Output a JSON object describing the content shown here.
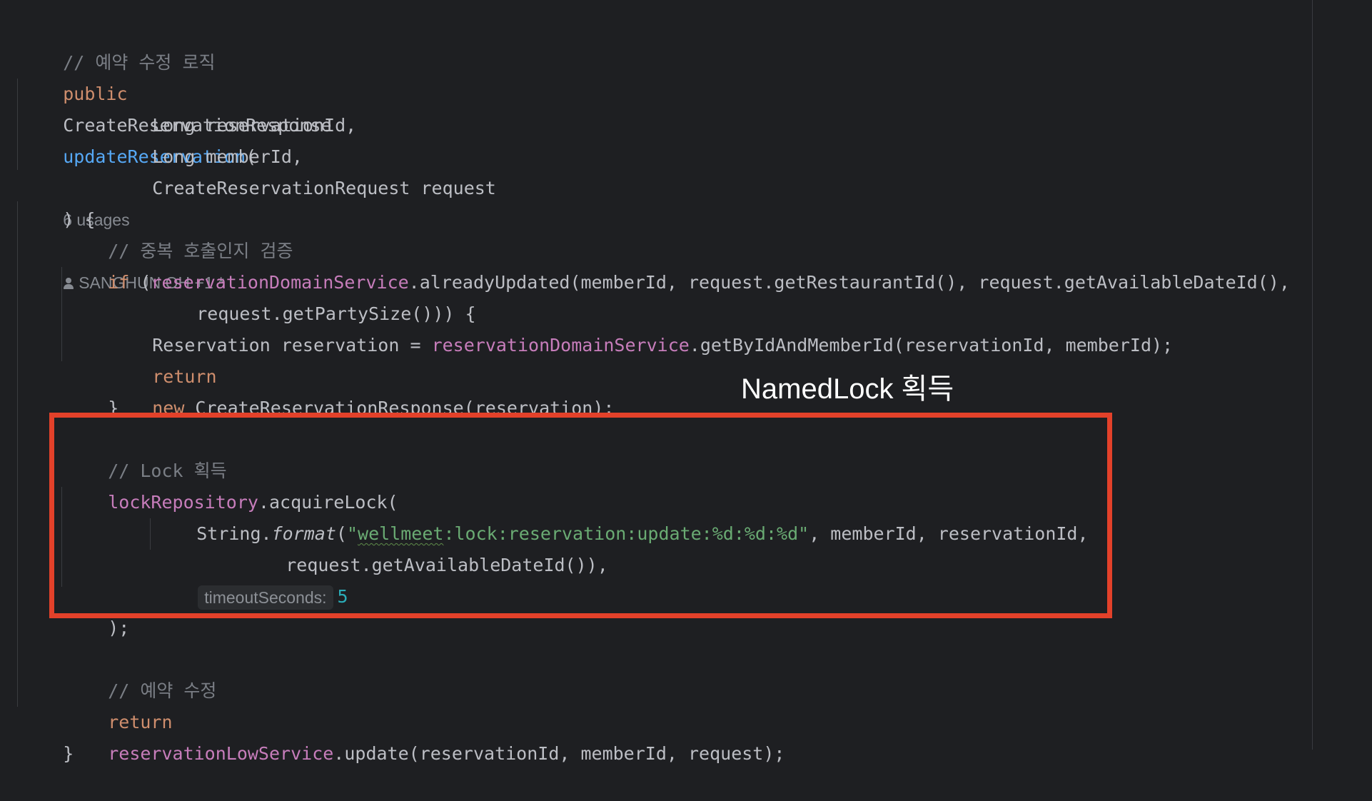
{
  "code": {
    "comment_update_logic": "// 예약 수정 로직",
    "kw_public": "public",
    "return_type": "CreateReservationResponse",
    "method_name": "updateReservation",
    "paren_open": "(",
    "usages_hint": "6 usages",
    "author_hint": "SANGHUN OH +1 *",
    "param_reservation_id": "Long reservationId,",
    "param_member_id": "Long memberId,",
    "param_request": "CreateReservationRequest request",
    "close_params": ") {",
    "comment_duplicate": "// 중복 호출인지 검증",
    "kw_if": "if",
    "if_open": " (",
    "field_domain_service": "reservationDomainService",
    "already_updated_call": ".alreadyUpdated(memberId, request.getRestaurantId(), request.getAvailableDateId(),",
    "party_size_call": "request.getPartySize())) {",
    "reservation_decl": "Reservation reservation = ",
    "get_by_id_call": ".getByIdAndMemberId(reservationId, memberId);",
    "kw_return": "return",
    "kw_new": "new",
    "new_response_call": " CreateReservationResponse(reservation);",
    "close_if": "}",
    "comment_lock": "// Lock 획득",
    "field_lock_repository": "lockRepository",
    "acquire_lock_call": ".acquireLock(",
    "string_class": "String.",
    "format_method": "format",
    "format_open": "(",
    "string_quote_open": "\"",
    "string_squiggle_part": "wellmeet",
    "string_rest": ":lock:reservation:update:%d:%d:%d\"",
    "format_args": ", memberId, reservationId,",
    "available_date_call": "request.getAvailableDateId()),",
    "timeout_hint_label": "timeoutSeconds:",
    "timeout_value": "5",
    "close_acquire": ");",
    "comment_update": "// 예약 수정",
    "field_low_service": "reservationLowService",
    "update_call": ".update(reservationId, memberId, request);",
    "close_method": "}"
  },
  "annotation": {
    "label": "NamedLock 획득",
    "box_color": "#e3412a"
  },
  "colors": {
    "background": "#1e1f22",
    "keyword": "#cf8e6d",
    "method": "#56a8f5",
    "field": "#c77dbb",
    "string": "#6aab73",
    "number": "#2aacb8",
    "comment": "#7a7e85",
    "text": "#bcbec4"
  }
}
